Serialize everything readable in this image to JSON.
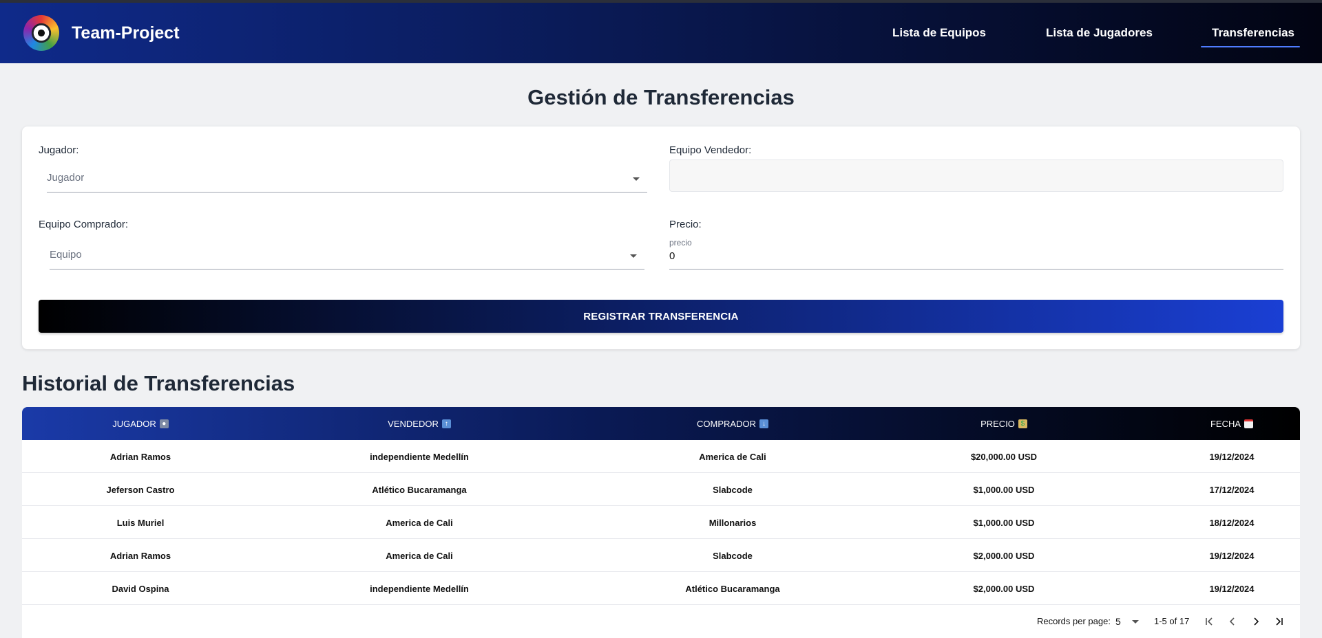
{
  "app": {
    "brand": "Team-Project"
  },
  "nav": {
    "items": [
      {
        "label": "Lista de Equipos"
      },
      {
        "label": "Lista de Jugadores"
      },
      {
        "label": "Transferencias",
        "active": true
      }
    ]
  },
  "page": {
    "title": "Gestión de Transferencias"
  },
  "form": {
    "jugador": {
      "label": "Jugador:",
      "placeholder": "Jugador"
    },
    "vendedor": {
      "label": "Equipo Vendedor:",
      "value": ""
    },
    "comprador": {
      "label": "Equipo Comprador:",
      "placeholder": "Equipo"
    },
    "precio": {
      "label": "Precio:",
      "field_label": "precio",
      "value": "0"
    },
    "submit_label": "REGISTRAR TRANSFERENCIA"
  },
  "history": {
    "title": "Historial de Transferencias",
    "columns": [
      "JUGADOR",
      "VENDEDOR",
      "COMPRADOR",
      "PRECIO",
      "FECHA"
    ],
    "column_icons": [
      "user-icon",
      "upload-icon",
      "download-icon",
      "money-icon",
      "calendar-icon"
    ],
    "rows": [
      [
        "Adrian Ramos",
        "independiente Medellín",
        "America de Cali",
        "$20,000.00 USD",
        "19/12/2024"
      ],
      [
        "Jeferson Castro",
        "Atlético Bucaramanga",
        "Slabcode",
        "$1,000.00 USD",
        "17/12/2024"
      ],
      [
        "Luis Muriel",
        "America de Cali",
        "Millonarios",
        "$1,000.00 USD",
        "18/12/2024"
      ],
      [
        "Adrian Ramos",
        "America de Cali",
        "Slabcode",
        "$2,000.00 USD",
        "19/12/2024"
      ],
      [
        "David Ospina",
        "independiente Medellín",
        "Atlético Bucaramanga",
        "$2,000.00 USD",
        "19/12/2024"
      ]
    ]
  },
  "pagination": {
    "records_label": "Records per page:",
    "per_page": "5",
    "range": "1-5 of 17"
  },
  "colors": {
    "accent": "#1a3fd4",
    "nav_dark": "#020412"
  }
}
